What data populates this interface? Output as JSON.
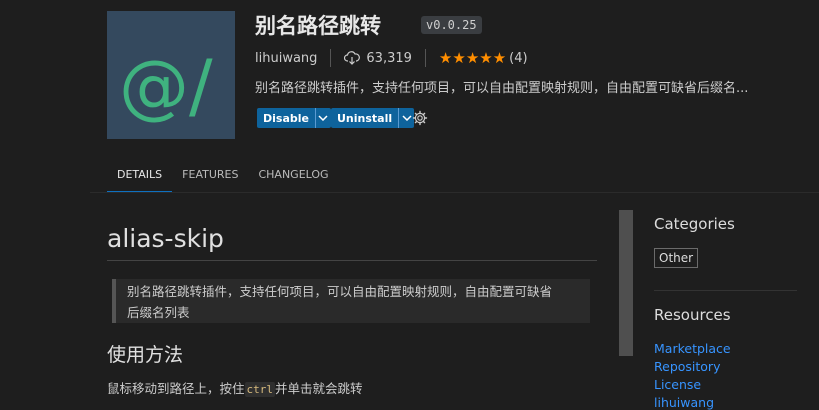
{
  "extension": {
    "logo_text": "@/",
    "logo_bg": "#34495e",
    "logo_fg": "#3fb27f",
    "title": "别名路径跳转",
    "version": "v0.0.25",
    "publisher": "lihuiwang",
    "downloads": "63,319",
    "rating_stars": 5,
    "rating_count": "(4)",
    "description": "别名路径跳转插件，支持任何项目，可以自由配置映射规则，自由配置可缺省后缀名..."
  },
  "actions": {
    "disable_label": "Disable",
    "uninstall_label": "Uninstall"
  },
  "tabs": [
    {
      "label": "DETAILS",
      "active": true
    },
    {
      "label": "FEATURES",
      "active": false
    },
    {
      "label": "CHANGELOG",
      "active": false
    }
  ],
  "readme": {
    "title": "alias-skip",
    "quote_line1": "别名路径跳转插件，支持任何项目，可以自由配置映射规则，自由配置可缺省",
    "quote_line2": "后缀名列表",
    "section_heading": "使用方法",
    "para_before": "鼠标移动到路径上，按住",
    "para_code": "ctrl",
    "para_after": "并单击就会跳转"
  },
  "sidebar": {
    "categories_heading": "Categories",
    "category": "Other",
    "resources_heading": "Resources",
    "links": [
      "Marketplace",
      "Repository",
      "License",
      "lihuiwang"
    ]
  },
  "colors": {
    "accent_button": "#0e639c",
    "star": "#ff8e00",
    "link": "#3794ff"
  },
  "icons": [
    "cloud-download-icon",
    "star-icon",
    "chevron-down-icon",
    "gear-icon"
  ]
}
